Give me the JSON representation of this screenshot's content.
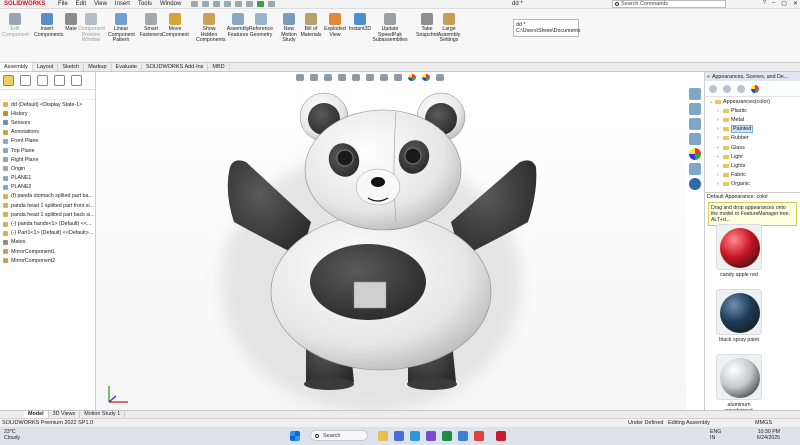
{
  "app": {
    "logo": "SOLIDWORKS",
    "menu": [
      "File",
      "Edit",
      "View",
      "Insert",
      "Tools",
      "Window"
    ],
    "doc_title": "dd *",
    "search_placeholder": "Search Commands"
  },
  "ribbon": {
    "buttons": [
      {
        "label": "Edit\nComponent",
        "dim": true,
        "icon": "edit-component-icon",
        "color": "#9aa5b1"
      },
      {
        "label": "Insert\nComponents",
        "dim": false,
        "icon": "insert-components-icon",
        "color": "#5a8fc9"
      },
      {
        "label": "Mate",
        "dim": false,
        "icon": "mate-icon",
        "color": "#8c8c8c"
      },
      {
        "label": "Component\nPreview\nWindow",
        "dim": true,
        "icon": "component-preview-icon",
        "color": "#b5bdc6"
      },
      {
        "label": "Linear\nComponent\nPattern",
        "dim": false,
        "icon": "linear-pattern-icon",
        "color": "#6f9fd0"
      },
      {
        "label": "Smart\nFasteners",
        "dim": false,
        "icon": "smart-fasteners-icon",
        "color": "#a0a8b0"
      },
      {
        "label": "Move\nComponent",
        "dim": false,
        "icon": "move-component-icon",
        "color": "#d4a33a"
      },
      {
        "label": "Show\nHidden\nComponents",
        "dim": false,
        "icon": "show-hidden-icon",
        "color": "#c9a457"
      },
      {
        "label": "Assembly\nFeatures",
        "dim": false,
        "icon": "assembly-features-icon",
        "color": "#8aa8c4"
      },
      {
        "label": "Reference\nGeometry",
        "dim": false,
        "icon": "reference-geometry-icon",
        "color": "#9ab4cc"
      },
      {
        "label": "New\nMotion\nStudy",
        "dim": false,
        "icon": "motion-study-icon",
        "color": "#7a9bbb"
      },
      {
        "label": "Bill of\nMaterials",
        "dim": false,
        "icon": "bom-icon",
        "color": "#b3a06b"
      },
      {
        "label": "Exploded\nView",
        "dim": false,
        "icon": "exploded-view-icon",
        "color": "#e0893a"
      },
      {
        "label": "Instant3D",
        "dim": false,
        "icon": "instant3d-icon",
        "color": "#4e8fcf"
      },
      {
        "label": "Update\nSpeedPak\nSubassemblies",
        "dim": false,
        "icon": "speedpak-icon",
        "color": "#9aa0a8"
      },
      {
        "label": "Take\nSnapshot",
        "dim": false,
        "icon": "snapshot-icon",
        "color": "#8e8e8e"
      },
      {
        "label": "Large\nAssembly\nSettings",
        "dim": false,
        "icon": "large-assembly-icon",
        "color": "#c79e55"
      }
    ],
    "doc_path": [
      "dd *",
      "C:\\Users\\Shree\\Documents"
    ]
  },
  "tabs": [
    "Assembly",
    "Layout",
    "Sketch",
    "Markup",
    "Evaluate",
    "SOLIDWORKS Add-Ins",
    "MBD"
  ],
  "active_tab": "Assembly",
  "tree": [
    {
      "label": "dd (Default) <Display State-1>",
      "color": "#d6b44b"
    },
    {
      "label": "History",
      "color": "#c0902f"
    },
    {
      "label": "Sensors",
      "color": "#6e8fb3"
    },
    {
      "label": "Annotations",
      "color": "#c9a64a"
    },
    {
      "label": "Front Plane",
      "color": "#8aa6c4"
    },
    {
      "label": "Top Plane",
      "color": "#8aa6c4"
    },
    {
      "label": "Right Plane",
      "color": "#8aa6c4"
    },
    {
      "label": "Origin",
      "color": "#a8a8a8"
    },
    {
      "label": "PLANE1",
      "color": "#8aa6c4"
    },
    {
      "label": "PLANE2",
      "color": "#8aa6c4"
    },
    {
      "label": "(f) panda stomach splited part ba...",
      "color": "#d1b35b"
    },
    {
      "label": "panda head 1 splitted part front si...",
      "color": "#d1b35b"
    },
    {
      "label": "panda head 1 splitted part back si...",
      "color": "#d1b35b"
    },
    {
      "label": "(-) panda hands<1> (Default) <<...",
      "color": "#d1b35b"
    },
    {
      "label": "(-) Part1<1> (Default) <<Default>...",
      "color": "#d1b35b"
    },
    {
      "label": "Mates",
      "color": "#8f8f8f"
    },
    {
      "label": "MirrorComponent1",
      "color": "#c89f56"
    },
    {
      "label": "MirrorComponent2",
      "color": "#c89f56"
    }
  ],
  "task_pane": {
    "header": "Appearances, Scenes, and De...",
    "root": "Appearances(color)",
    "items": [
      "Plastic",
      "Metal",
      "Painted",
      "Rubber",
      "Glass",
      "Light",
      "Lights",
      "Fabric",
      "Organic"
    ],
    "selected": "Painted",
    "default_appearance": "Default Appearance: color",
    "tooltip": "Drag and drop appearances onto the model or FeatureManager tree.  ALT+d...",
    "swatches": [
      {
        "name": "candy apple red",
        "color": "#c81422",
        "highlight": "#ff8a8a"
      },
      {
        "name": "black spray paint",
        "color": "#1d3b56",
        "highlight": "#6f8fb0"
      },
      {
        "name": "aluminum powdercoat",
        "color": "#c7c9cc",
        "highlight": "#ffffff"
      }
    ]
  },
  "model_tabs": [
    "Model",
    "3D Views",
    "Motion Study 1"
  ],
  "active_model_tab": "Model",
  "status": {
    "left": "SOLIDWORKS Premium 2022 SP1.0",
    "under_defined": "Under Defined",
    "editing": "Editing Assembly",
    "units": "MMGS"
  },
  "taskbar": {
    "temp": "23°C",
    "weather": "Cloudy",
    "search": "Search",
    "lang": "ENG",
    "region": "IN",
    "time": "10:30 PM",
    "date": "6/24/2025"
  },
  "colors": {
    "panda_white": "#f2f2f2",
    "panda_black": "#3a3a3a",
    "bow": "#c51d1d",
    "accent_red": "#d0112b"
  }
}
